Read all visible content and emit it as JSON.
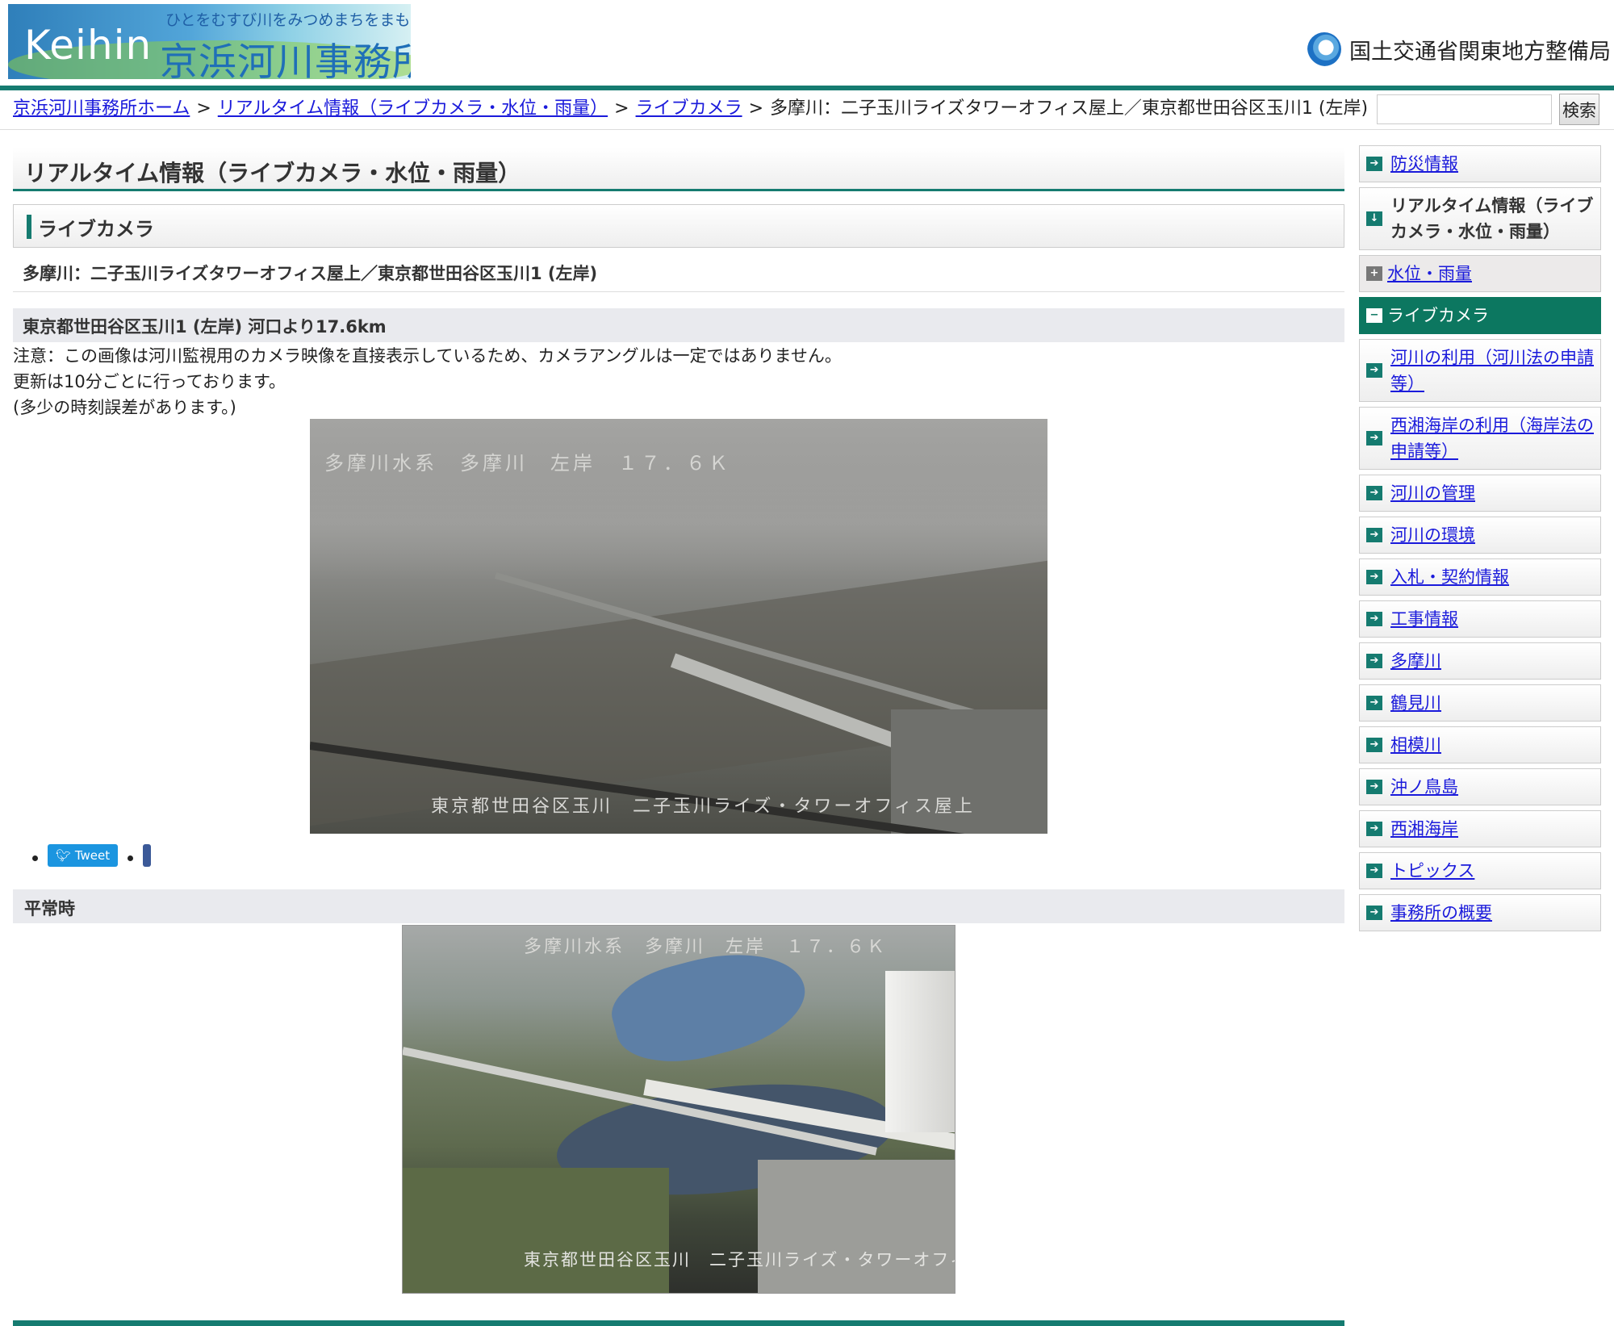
{
  "header": {
    "logo_en": "Keihin",
    "logo_tagline": "ひとをむすび川をみつめまちをまもる",
    "logo_jp": "京浜河川事務所",
    "ministry": "国土交通省関東地方整備局"
  },
  "breadcrumb": {
    "items": [
      "京浜河川事務所ホーム",
      "リアルタイム情報（ライブカメラ・水位・雨量）",
      "ライブカメラ"
    ],
    "current": "多摩川：二子玉川ライズタワーオフィス屋上／東京都世田谷区玉川1 (左岸)",
    "separator": ">"
  },
  "search": {
    "value": "",
    "button": "検索"
  },
  "main": {
    "page_title": "リアルタイム情報（ライブカメラ・水位・雨量）",
    "section_title": "ライブカメラ",
    "location_heading": "多摩川：二子玉川ライズタワーオフィス屋上／東京都世田谷区玉川1 (左岸)",
    "sub_heading": "東京都世田谷区玉川1 (左岸) 河口より17.6km",
    "notes": [
      "注意：この画像は河川監視用のカメラ映像を直接表示しているため、カメラアングルは一定ではありません。",
      "更新は10分ごとに行っております。",
      "(多少の時刻誤差があります。)"
    ],
    "live_camera": {
      "top_label": "多摩川水系　多摩川　左岸　１７．６Ｋ",
      "bottom_label": "東京都世田谷区玉川　二子玉川ライズ・タワーオフィス屋上"
    },
    "social": {
      "tweet": "Tweet"
    },
    "normal_heading": "平常時",
    "normal_camera": {
      "top_label": "多摩川水系　多摩川　左岸　１７．６Ｋ",
      "bottom_label": "東京都世田谷区玉川　二子玉川ライズ・タワーオフィス屋上"
    }
  },
  "sidebar": {
    "items": [
      {
        "label": "防災情報",
        "type": "link"
      },
      {
        "label": "リアルタイム情報（ライブカメラ・水位・雨量）",
        "type": "current"
      },
      {
        "label": "水位・雨量",
        "type": "sub"
      },
      {
        "label": "ライブカメラ",
        "type": "active"
      },
      {
        "label": "河川の利用（河川法の申請等）",
        "type": "link"
      },
      {
        "label": "西湘海岸の利用（海岸法の申請等）",
        "type": "link"
      },
      {
        "label": "河川の管理",
        "type": "link"
      },
      {
        "label": "河川の環境",
        "type": "link"
      },
      {
        "label": "入札・契約情報",
        "type": "link"
      },
      {
        "label": "工事情報",
        "type": "link"
      },
      {
        "label": "多摩川",
        "type": "link"
      },
      {
        "label": "鶴見川",
        "type": "link"
      },
      {
        "label": "相模川",
        "type": "link"
      },
      {
        "label": "沖ノ鳥島",
        "type": "link"
      },
      {
        "label": "西湘海岸",
        "type": "link"
      },
      {
        "label": "トピックス",
        "type": "link"
      },
      {
        "label": "事務所の概要",
        "type": "link"
      }
    ]
  },
  "colors": {
    "accent": "#157b70",
    "active_nav": "#0c7760",
    "link": "#1a1adb"
  }
}
